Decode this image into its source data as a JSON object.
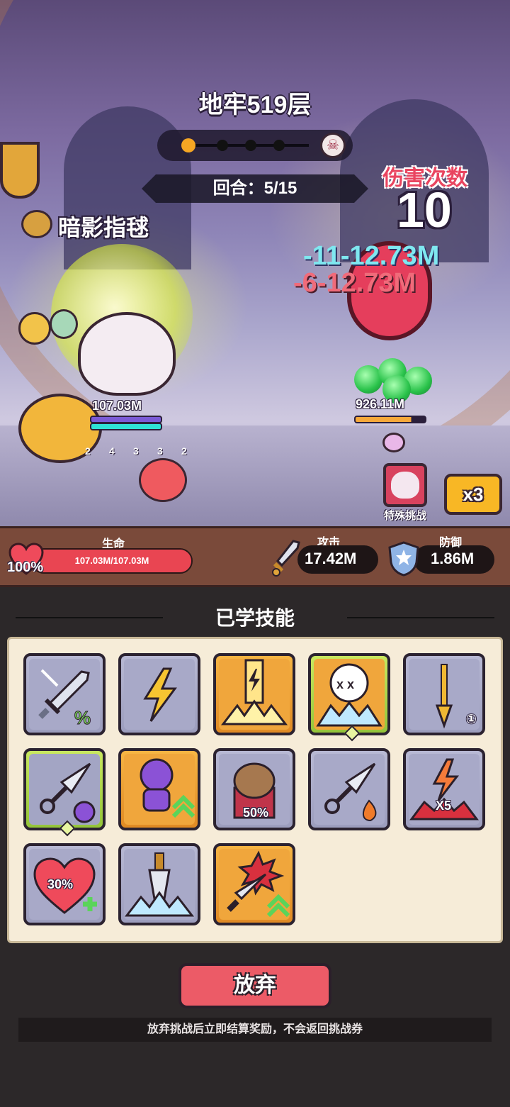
{
  "stage": {
    "title": "地牢519层",
    "round_label": "回合：5/15"
  },
  "progress": {
    "current": 1,
    "total": 5
  },
  "hits": {
    "label": "伤害次数",
    "value": "10"
  },
  "damage_popups": [
    {
      "text": "-11-12.73M",
      "color": "teal"
    },
    {
      "text": "-6-12.73M",
      "color": "red"
    }
  ],
  "artifact": {
    "name": "暗影指毬"
  },
  "player": {
    "hp_text": "107.03M",
    "buff_counts": [
      "2",
      "4",
      "3",
      "3",
      "2"
    ]
  },
  "enemy": {
    "hp_text": "926.11M"
  },
  "controls": {
    "special_label": "特殊挑战",
    "speed_label": "x3"
  },
  "stats": {
    "hp_title": "生命",
    "hp_value": "107.03M/107.03M",
    "hp_percent": "100%",
    "hp_fraction": 1.0,
    "atk_title": "攻击",
    "atk_value": "17.42M",
    "def_title": "防御",
    "def_value": "1.86M"
  },
  "skills_section": {
    "title": "已学技能",
    "skills": [
      {
        "icon": "sword-crit-icon",
        "frame": "grey",
        "tag": ""
      },
      {
        "icon": "lightning-icon",
        "frame": "grey",
        "tag": ""
      },
      {
        "icon": "lightning-strike-icon",
        "frame": "gold",
        "tag": ""
      },
      {
        "icon": "skull-freeze-icon",
        "frame": "green",
        "tag": ""
      },
      {
        "icon": "golden-spear-icon",
        "frame": "grey",
        "tag": "①"
      },
      {
        "icon": "kunai-poison-icon",
        "frame": "green",
        "tag": ""
      },
      {
        "icon": "voodoo-doll-icon",
        "frame": "gold",
        "tag": ""
      },
      {
        "icon": "capybara-icon",
        "frame": "grey",
        "tag": "50%"
      },
      {
        "icon": "kunai-fire-icon",
        "frame": "grey",
        "tag": ""
      },
      {
        "icon": "lightning-x5-icon",
        "frame": "grey",
        "tag": "X5"
      },
      {
        "icon": "heart-heal-icon",
        "frame": "grey",
        "tag": "30%"
      },
      {
        "icon": "ice-sword-icon",
        "frame": "grey",
        "tag": ""
      },
      {
        "icon": "sword-burst-icon",
        "frame": "gold",
        "tag": ""
      }
    ]
  },
  "actions": {
    "give_up_label": "放弃",
    "notice": "放弃挑战后立即结算奖励，不会返回挑战券"
  },
  "colors": {
    "accent": "#ec5b67",
    "hp_bar": "#e94552",
    "speed": "#f8b725"
  }
}
